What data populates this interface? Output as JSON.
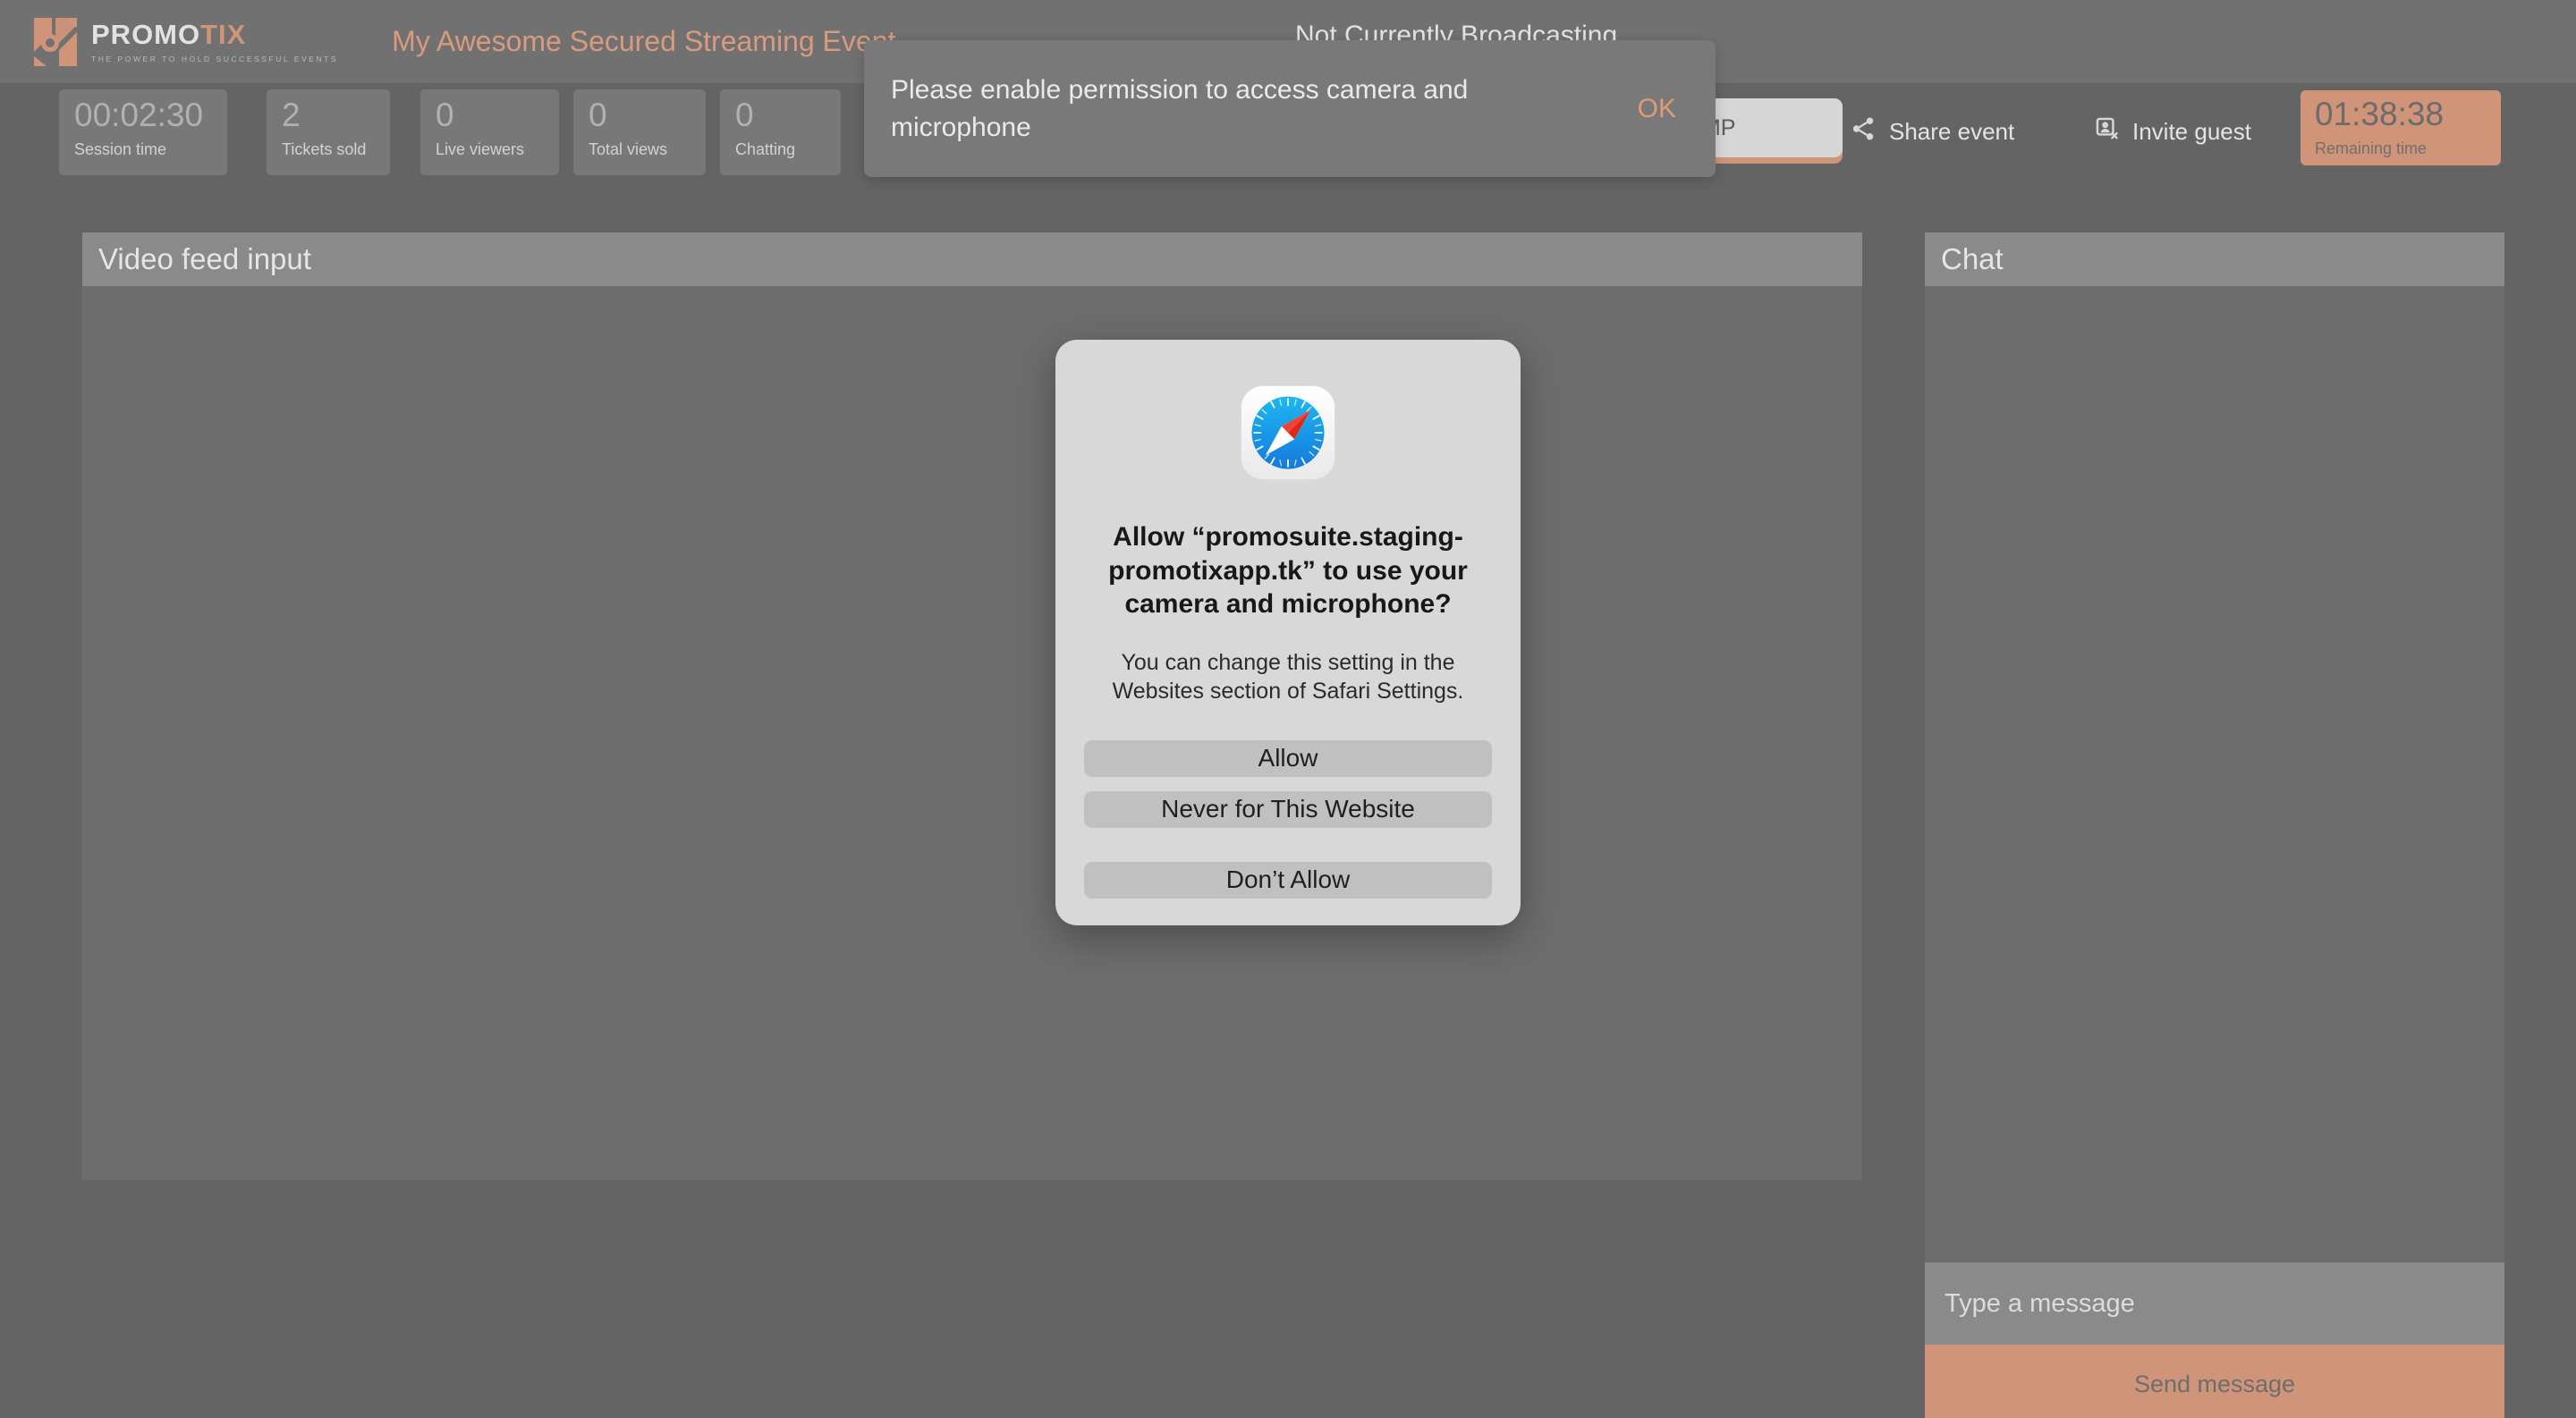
{
  "brand": {
    "name_part1": "PROMO",
    "name_part2": "TIX",
    "tagline": "THE POWER TO HOLD SUCCESSFUL EVENTS",
    "accent_color": "#d09478"
  },
  "header": {
    "event_title": "My Awesome Secured Streaming Event",
    "broadcast_status": "Not Currently Broadcasting"
  },
  "stats": [
    {
      "value": "00:02:30",
      "label": "Session time"
    },
    {
      "value": "2",
      "label": "Tickets sold"
    },
    {
      "value": "0",
      "label": "Live viewers"
    },
    {
      "value": "0",
      "label": "Total views"
    },
    {
      "value": "0",
      "label": "Chatting"
    }
  ],
  "toolbar": {
    "stream_button_label": "",
    "rtmp_button_label": "TMP",
    "share_label": "Share event",
    "invite_label": "Invite guest",
    "remaining_value": "01:38:38",
    "remaining_label": "Remaining time"
  },
  "video_panel": {
    "title": "Video feed input"
  },
  "chat_panel": {
    "title": "Chat",
    "input_placeholder": "Type a message",
    "input_value": "",
    "send_label": "Send message"
  },
  "snackbar": {
    "message": "Please enable permission to access camera and microphone",
    "action_label": "OK"
  },
  "safari_dialog": {
    "title": "Allow “promosuite.staging-promotixapp.tk” to use your camera and microphone?",
    "subtitle": "You can change this setting in the Websites section of Safari Settings.",
    "allow_label": "Allow",
    "never_label": "Never for This Website",
    "deny_label": "Don’t Allow"
  }
}
